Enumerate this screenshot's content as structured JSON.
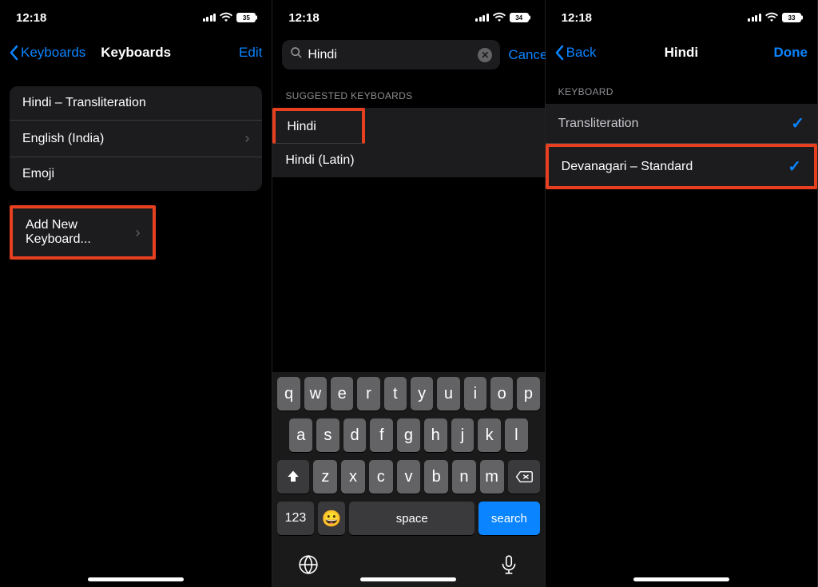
{
  "accent_color": "#0a84ff",
  "highlight_color": "#e74020",
  "screen1": {
    "status_time": "12:18",
    "battery": "35",
    "nav_back": "Keyboards",
    "nav_title": "Keyboards",
    "nav_edit": "Edit",
    "list": [
      "Hindi – Transliteration",
      "English (India)",
      "Emoji"
    ],
    "add_new": "Add New Keyboard..."
  },
  "screen2": {
    "status_time": "12:18",
    "battery": "34",
    "search_value": "Hindi",
    "cancel": "Cancel",
    "section_label": "Suggested Keyboards",
    "suggestions": [
      "Hindi",
      "Hindi (Latin)"
    ],
    "keyboard": {
      "row1": [
        "q",
        "w",
        "e",
        "r",
        "t",
        "y",
        "u",
        "i",
        "o",
        "p"
      ],
      "row2": [
        "a",
        "s",
        "d",
        "f",
        "g",
        "h",
        "j",
        "k",
        "l"
      ],
      "row3": [
        "z",
        "x",
        "c",
        "v",
        "b",
        "n",
        "m"
      ],
      "numkey": "123",
      "space": "space",
      "search": "search"
    }
  },
  "screen3": {
    "status_time": "12:18",
    "battery": "33",
    "nav_back": "Back",
    "nav_title": "Hindi",
    "nav_done": "Done",
    "section_label": "Keyboard",
    "options": [
      {
        "label": "Transliteration",
        "checked": true
      },
      {
        "label": "Devanagari – Standard",
        "checked": true
      }
    ]
  }
}
